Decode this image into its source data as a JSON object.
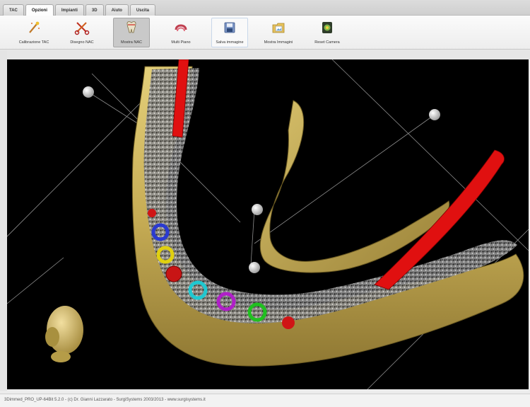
{
  "tabs": [
    {
      "label": "TAC"
    },
    {
      "label": "Opzioni"
    },
    {
      "label": "Impianti"
    },
    {
      "label": "3D"
    },
    {
      "label": "Aiuto"
    },
    {
      "label": "Uscita"
    }
  ],
  "active_tab": "Opzioni",
  "toolbar": {
    "buttons": [
      {
        "label": "Calibrazione TAC",
        "icon": "wand-icon"
      },
      {
        "label": "Disegno NAC",
        "icon": "scissors-icon"
      },
      {
        "label": "Mostra NAC",
        "icon": "tooth-icon",
        "state": "selected"
      },
      {
        "label": "Multi Piano",
        "icon": "multiplane-icon"
      },
      {
        "label": "Salva immagine",
        "icon": "save-image-icon",
        "state": "hover"
      },
      {
        "label": "Mostra Immagini",
        "icon": "images-folder-icon"
      },
      {
        "label": "Reset Camera",
        "icon": "camera-reset-icon"
      }
    ]
  },
  "statusbar": {
    "text": "3Dimmed_PRO_UP-64Bit 5.2.0 - (c) Dr. Gianni Lazzarato - SurgiSystems 2003/2013 - www.surgisystems.it"
  },
  "colors": {
    "bone": "#c9b25a",
    "nerve": "#e01010",
    "viewport_bg": "#000000"
  }
}
